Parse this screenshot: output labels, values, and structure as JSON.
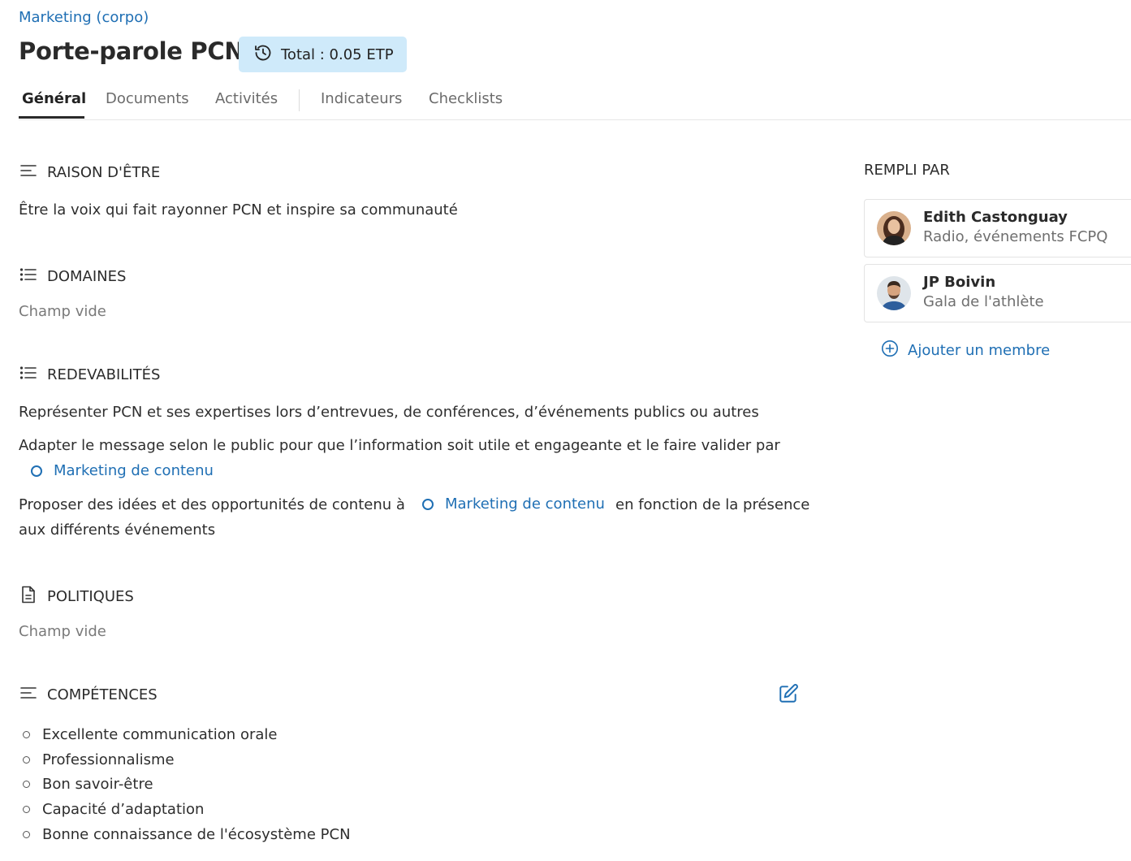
{
  "breadcrumb": "Marketing (corpo)",
  "page_title": "Porte-parole PCN",
  "etp_badge": {
    "label": "Total : 0.05 ETP",
    "icon": "history-icon"
  },
  "tabs": [
    {
      "label": "Général",
      "active": true
    },
    {
      "label": "Documents",
      "active": false
    },
    {
      "label": "Activités",
      "active": false
    },
    {
      "label": "Indicateurs",
      "active": false
    },
    {
      "label": "Checklists",
      "active": false
    }
  ],
  "sections": {
    "raison_detre": {
      "title": "RAISON D'ÊTRE",
      "icon": "text-align-icon",
      "text": "Être la voix qui fait rayonner PCN et inspire sa communauté"
    },
    "domaines": {
      "title": "DOMAINES",
      "icon": "list-icon",
      "empty": "Champ vide"
    },
    "redevabilites": {
      "title": "REDEVABILITÉS",
      "icon": "list-icon",
      "items": [
        {
          "text": "Représenter PCN et ses expertises lors d’entrevues, de conférences, d’événements publics ou autres"
        },
        {
          "text": "Adapter le message selon le public pour que l’information soit utile et engageante et le faire valider par",
          "link": "Marketing de contenu"
        },
        {
          "text_before": "Proposer des idées et des opportunités de contenu à",
          "link": "Marketing de contenu",
          "text_after": "en fonction de la présence",
          "text_line2": "aux différents événements"
        }
      ]
    },
    "politiques": {
      "title": "POLITIQUES",
      "icon": "document-icon",
      "empty": "Champ vide"
    },
    "competences": {
      "title": "COMPÉTENCES",
      "icon": "text-align-icon",
      "edit_icon": "edit-icon",
      "items": [
        "Excellente communication orale",
        "Professionnalisme",
        "Bon savoir-être",
        "Capacité d’adaptation",
        "Bonne connaissance de l'écosystème PCN"
      ]
    }
  },
  "rempli_par": {
    "title": "REMPLI PAR",
    "members": [
      {
        "name": "Edith Castonguay",
        "subtitle": "Radio, événements FCPQ",
        "avatar": "avatar-woman"
      },
      {
        "name": "JP Boivin",
        "subtitle": "Gala de l'athlète",
        "avatar": "avatar-man"
      }
    ],
    "add_label": "Ajouter un membre",
    "add_icon": "plus-circle-icon"
  },
  "colors": {
    "accent": "#1f6fb4",
    "badge_bg": "#cfeafa",
    "text": "#2b2b2b",
    "muted": "#7a7a7a"
  }
}
